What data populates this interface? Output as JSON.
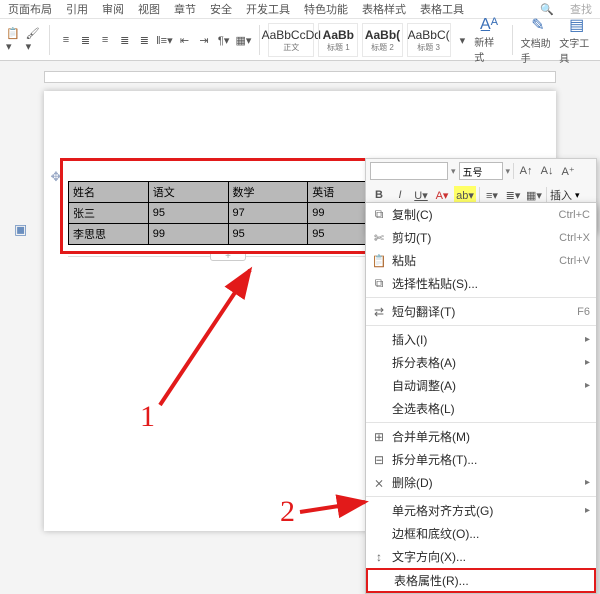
{
  "ribbon": {
    "tabs": [
      "页面布局",
      "引用",
      "审阅",
      "视图",
      "章节",
      "安全",
      "开发工具",
      "特色功能",
      "表格样式",
      "表格工具"
    ],
    "search_placeholder": "查找",
    "style_tiles": [
      {
        "sample": "AaBbCcDd",
        "label": "正文"
      },
      {
        "sample": "AaBb",
        "label": "标题 1"
      },
      {
        "sample": "AaBb(",
        "label": "标题 2"
      },
      {
        "sample": "AaBbC(",
        "label": "标题 3"
      }
    ],
    "new_style": "新样式",
    "doc_assistant": "文档助手",
    "text_tool": "文字工具"
  },
  "mini_toolbar": {
    "font_name": "",
    "font_size_label": "五号",
    "insert_label": "插入"
  },
  "table": {
    "headers": [
      "姓名",
      "语文",
      "数学",
      "英语"
    ],
    "rows": [
      [
        "张三",
        "95",
        "97",
        "99"
      ],
      [
        "李思思",
        "99",
        "95",
        "95"
      ]
    ]
  },
  "context_menu": {
    "copy": {
      "label": "复制(C)",
      "shortcut": "Ctrl+C"
    },
    "cut": {
      "label": "剪切(T)",
      "shortcut": "Ctrl+X"
    },
    "paste": {
      "label": "粘贴",
      "shortcut": "Ctrl+V"
    },
    "paste_special": "选择性粘贴(S)...",
    "short_translate": {
      "label": "短句翻译(T)",
      "shortcut": "F6"
    },
    "insert": "插入(I)",
    "split_table": "拆分表格(A)",
    "autofit": "自动调整(A)",
    "select_table": "全选表格(L)",
    "merge_cells": "合并单元格(M)",
    "split_cells": "拆分单元格(T)...",
    "delete": "删除(D)",
    "cell_align": "单元格对齐方式(G)",
    "borders_shading": "边框和底纹(O)...",
    "text_direction": "文字方向(X)...",
    "table_properties": "表格属性(R)..."
  },
  "annotations": {
    "label_1": "1",
    "label_2": "2"
  }
}
